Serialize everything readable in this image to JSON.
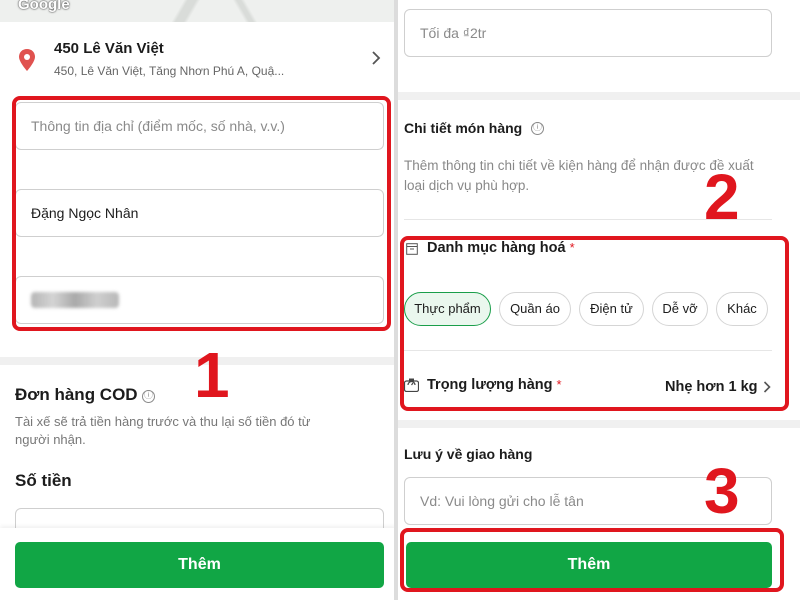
{
  "left": {
    "map": {
      "logo": "Google"
    },
    "address": {
      "title": "450 Lê Văn Việt",
      "subtitle": "450, Lê Văn Việt, Tăng Nhơn Phú A, Quậ..."
    },
    "fields": {
      "address_info_placeholder": "Thông tin địa chỉ (điểm mốc, số nhà, v.v.)",
      "name_value": "Đặng Ngọc Nhân"
    },
    "cod": {
      "title": "Đơn hàng COD",
      "info_icon": "ⓘ",
      "description": "Tài xế sẽ trả tiền hàng trước và thu lại số tiền đó từ người nhận.",
      "amount_label": "Số tiền"
    },
    "add_button": "Thêm",
    "annotation": "1"
  },
  "right": {
    "max_field_placeholder": "Tối đa ₫2tr",
    "details": {
      "title": "Chi tiết món hàng",
      "info_icon": "ⓘ",
      "description": "Thêm thông tin chi tiết về kiện hàng để nhận được đề xuất loại dịch vụ phù hợp."
    },
    "category": {
      "title": "Danh mục hàng hoá",
      "required_mark": "*",
      "chips": [
        "Thực phẩm",
        "Quần áo",
        "Điện tử",
        "Dễ vỡ",
        "Khác"
      ],
      "selected": "Thực phẩm"
    },
    "weight": {
      "title": "Trọng lượng hàng",
      "required_mark": "*",
      "value": "Nhẹ hơn 1 kg"
    },
    "note": {
      "title": "Lưu ý về giao hàng",
      "placeholder": "Vd: Vui lòng gửi cho lễ tân"
    },
    "add_button": "Thêm",
    "annotations": [
      "2",
      "3"
    ]
  },
  "colors": {
    "primary_green": "#11a645",
    "highlight_red": "#e0161e",
    "pin_red": "#e0524f"
  },
  "icons": [
    "location-pin-icon",
    "chevron-right-icon",
    "info-icon",
    "box-icon",
    "scale-icon"
  ]
}
